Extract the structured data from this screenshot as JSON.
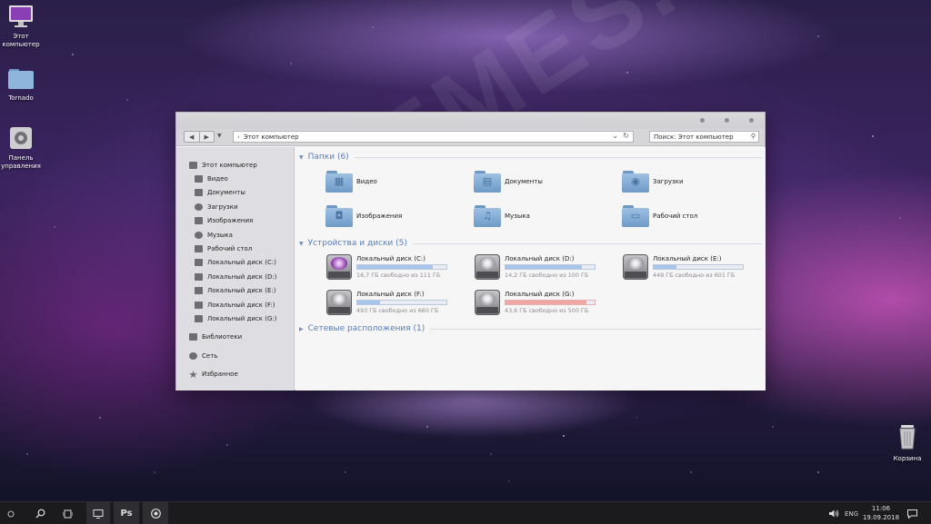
{
  "desktop": {
    "icons": [
      {
        "label": "Этот компьютер"
      },
      {
        "label": "Tornado"
      },
      {
        "label": "Панель управления"
      },
      {
        "label": "Корзина"
      }
    ]
  },
  "window": {
    "address": "Этот компьютер",
    "search_placeholder": "Поиск: Этот компьютер"
  },
  "sidebar": {
    "items": [
      {
        "label": "Этот компьютер"
      },
      {
        "label": "Видео"
      },
      {
        "label": "Документы"
      },
      {
        "label": "Загрузки"
      },
      {
        "label": "Изображения"
      },
      {
        "label": "Музыка"
      },
      {
        "label": "Рабочий стол"
      },
      {
        "label": "Локальный диск (C:)"
      },
      {
        "label": "Локальный диск (D:)"
      },
      {
        "label": "Локальный диск (E:)"
      },
      {
        "label": "Локальный диск (F:)"
      },
      {
        "label": "Локальный диск (G:)"
      },
      {
        "label": "Библиотеки"
      },
      {
        "label": "Сеть"
      },
      {
        "label": "Избранное"
      }
    ]
  },
  "content": {
    "folders_header": "Папки (6)",
    "folders": [
      {
        "label": "Видео",
        "icon": "film-icon"
      },
      {
        "label": "Документы",
        "icon": "document-icon"
      },
      {
        "label": "Загрузки",
        "icon": "download-icon"
      },
      {
        "label": "Изображения",
        "icon": "camera-icon"
      },
      {
        "label": "Музыка",
        "icon": "music-note-icon"
      },
      {
        "label": "Рабочий стол",
        "icon": "desktop-icon"
      }
    ],
    "drives_header": "Устройства и диски (5)",
    "drives": [
      {
        "label": "Локальный диск (C:)",
        "free": "16,7 ГБ свободно из 111 ГБ",
        "used_fraction": 0.85,
        "warn": false
      },
      {
        "label": "Локальный диск (D:)",
        "free": "14,2 ГБ свободно из 100 ГБ",
        "used_fraction": 0.86,
        "warn": false
      },
      {
        "label": "Локальный диск (E:)",
        "free": "449 ГБ свободно из 601 ГБ",
        "used_fraction": 0.25,
        "warn": false
      },
      {
        "label": "Локальный диск (F:)",
        "free": "493 ГБ свободно из 660 ГБ",
        "used_fraction": 0.25,
        "warn": false
      },
      {
        "label": "Локальный диск (G:)",
        "free": "43,6 ГБ свободно из 500 ГБ",
        "used_fraction": 0.91,
        "warn": true
      }
    ],
    "network_header": "Сетевые расположения (1)"
  },
  "taskbar": {
    "ps_label": "Ps",
    "lang": "ENG",
    "time": "11:06",
    "date": "19.09.2018"
  },
  "watermark": "MTHEMES.RU"
}
